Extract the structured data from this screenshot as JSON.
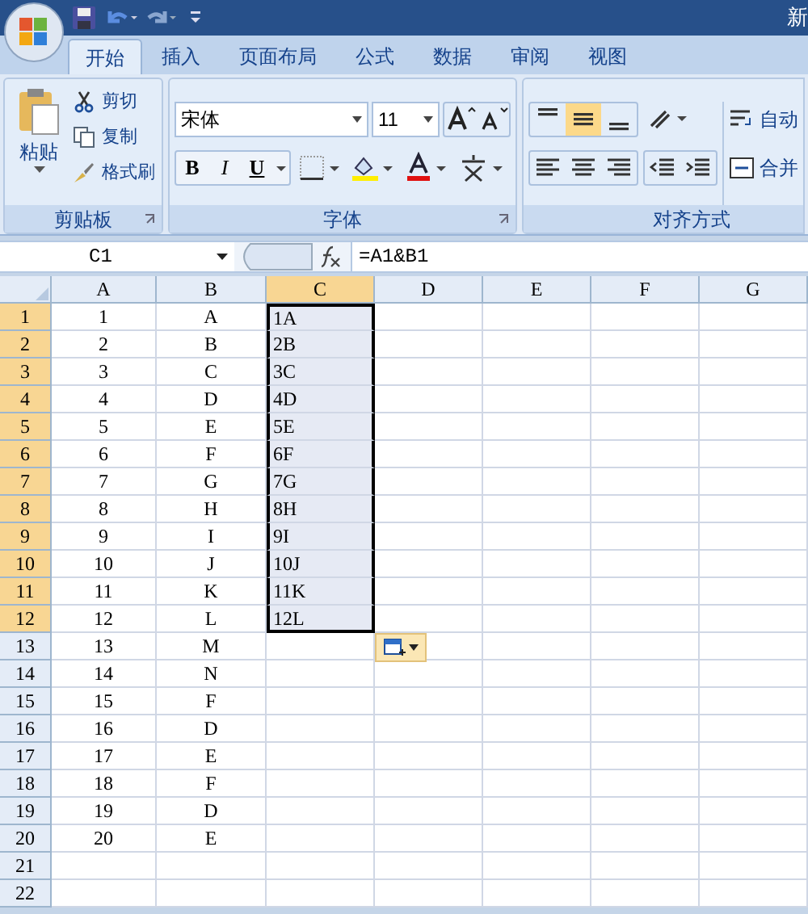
{
  "title_bar": {
    "title": "新"
  },
  "tabs": [
    {
      "label": "开始",
      "selected": true
    },
    {
      "label": "插入",
      "selected": false
    },
    {
      "label": "页面布局",
      "selected": false
    },
    {
      "label": "公式",
      "selected": false
    },
    {
      "label": "数据",
      "selected": false
    },
    {
      "label": "审阅",
      "selected": false
    },
    {
      "label": "视图",
      "selected": false
    }
  ],
  "clipboard": {
    "paste": "粘贴",
    "cut": "剪切",
    "copy": "复制",
    "format_painter": "格式刷",
    "group": "剪贴板"
  },
  "font": {
    "name": "宋体",
    "size": "11",
    "bold": "B",
    "italic": "I",
    "underline": "U",
    "group": "字体"
  },
  "alignment": {
    "vertical": [
      {
        "kind": "top",
        "selected": false
      },
      {
        "kind": "middle",
        "selected": true
      },
      {
        "kind": "bottom",
        "selected": false
      }
    ],
    "wrap": "自动",
    "merge": "合并",
    "group": "对齐方式"
  },
  "formula_bar": {
    "name_box": "C1",
    "formula": "=A1&B1"
  },
  "sheet": {
    "columns": [
      {
        "label": "A",
        "selected": false
      },
      {
        "label": "B",
        "selected": false
      },
      {
        "label": "C",
        "selected": true
      },
      {
        "label": "D",
        "selected": false
      },
      {
        "label": "E",
        "selected": false
      },
      {
        "label": "F",
        "selected": false
      },
      {
        "label": "G",
        "selected": false
      }
    ],
    "rows": [
      {
        "label": "1",
        "selected": true,
        "cells": [
          "1",
          "A",
          "1A"
        ]
      },
      {
        "label": "2",
        "selected": true,
        "cells": [
          "2",
          "B",
          "2B"
        ]
      },
      {
        "label": "3",
        "selected": true,
        "cells": [
          "3",
          "C",
          "3C"
        ]
      },
      {
        "label": "4",
        "selected": true,
        "cells": [
          "4",
          "D",
          "4D"
        ]
      },
      {
        "label": "5",
        "selected": true,
        "cells": [
          "5",
          "E",
          "5E"
        ]
      },
      {
        "label": "6",
        "selected": true,
        "cells": [
          "6",
          "F",
          "6F"
        ]
      },
      {
        "label": "7",
        "selected": true,
        "cells": [
          "7",
          "G",
          "7G"
        ]
      },
      {
        "label": "8",
        "selected": true,
        "cells": [
          "8",
          "H",
          "8H"
        ]
      },
      {
        "label": "9",
        "selected": true,
        "cells": [
          "9",
          "I",
          "9I"
        ]
      },
      {
        "label": "10",
        "selected": true,
        "cells": [
          "10",
          "J",
          "10J"
        ]
      },
      {
        "label": "11",
        "selected": true,
        "cells": [
          "11",
          "K",
          "11K"
        ]
      },
      {
        "label": "12",
        "selected": true,
        "cells": [
          "12",
          "L",
          "12L"
        ]
      },
      {
        "label": "13",
        "selected": false,
        "cells": [
          "13",
          "M"
        ]
      },
      {
        "label": "14",
        "selected": false,
        "cells": [
          "14",
          "N"
        ]
      },
      {
        "label": "15",
        "selected": false,
        "cells": [
          "15",
          "F"
        ]
      },
      {
        "label": "16",
        "selected": false,
        "cells": [
          "16",
          "D"
        ]
      },
      {
        "label": "17",
        "selected": false,
        "cells": [
          "17",
          "E"
        ]
      },
      {
        "label": "18",
        "selected": false,
        "cells": [
          "18",
          "F"
        ]
      },
      {
        "label": "19",
        "selected": false,
        "cells": [
          "19",
          "D"
        ]
      },
      {
        "label": "20",
        "selected": false,
        "cells": [
          "20",
          "E"
        ]
      },
      {
        "label": "21",
        "selected": false,
        "cells": []
      },
      {
        "label": "22",
        "selected": false,
        "cells": []
      }
    ]
  }
}
